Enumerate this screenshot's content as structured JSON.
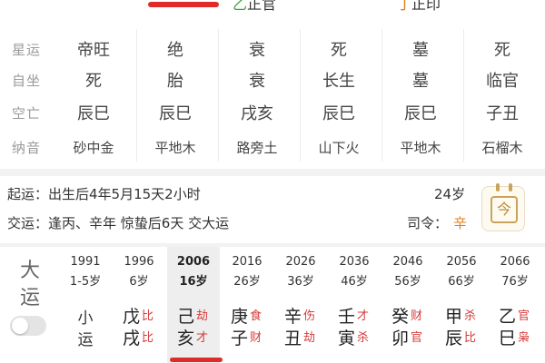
{
  "top": {
    "item1": {
      "glyph": "乙",
      "label": "正官"
    },
    "item2": {
      "glyph": "丁",
      "label": "正印"
    }
  },
  "pillars": {
    "rows": [
      {
        "label": "星运",
        "values": [
          "帝旺",
          "绝",
          "衰",
          "死",
          "墓",
          "死"
        ]
      },
      {
        "label": "自坐",
        "values": [
          "死",
          "胎",
          "衰",
          "长生",
          "墓",
          "临官"
        ]
      },
      {
        "label": "空亡",
        "values": [
          "辰巳",
          "辰巳",
          "戌亥",
          "辰巳",
          "辰巳",
          "子丑"
        ]
      },
      {
        "label": "纳音",
        "values": [
          "砂中金",
          "平地木",
          "路旁土",
          "山下火",
          "平地木",
          "石榴木"
        ]
      }
    ]
  },
  "qiyun": {
    "line1": "起运：出生后4年5月15天2小时",
    "age": "24岁",
    "line2": "交运：逢丙、辛年 惊蛰后6天 交大运",
    "siling_label": "司令：",
    "siling_value": "辛",
    "calendar_icon_char": "今"
  },
  "dayun": {
    "title_line1": "大",
    "title_line2": "运",
    "columns": [
      {
        "year": "1991",
        "age": "1-5岁",
        "xiao": [
          "小",
          "运"
        ]
      },
      {
        "year": "1996",
        "age": "6岁",
        "gan": "戊",
        "gan_ss": "比",
        "zhi": "戌",
        "zhi_ss": "比"
      },
      {
        "year": "2006",
        "age": "16岁",
        "gan": "己",
        "gan_ss": "劫",
        "zhi": "亥",
        "zhi_ss": "才"
      },
      {
        "year": "2016",
        "age": "26岁",
        "gan": "庚",
        "gan_ss": "食",
        "zhi": "子",
        "zhi_ss": "财"
      },
      {
        "year": "2026",
        "age": "36岁",
        "gan": "辛",
        "gan_ss": "伤",
        "zhi": "丑",
        "zhi_ss": "劫"
      },
      {
        "year": "2036",
        "age": "46岁",
        "gan": "壬",
        "gan_ss": "才",
        "zhi": "寅",
        "zhi_ss": "杀"
      },
      {
        "year": "2046",
        "age": "56岁",
        "gan": "癸",
        "gan_ss": "财",
        "zhi": "卯",
        "zhi_ss": "官"
      },
      {
        "year": "2056",
        "age": "66岁",
        "gan": "甲",
        "gan_ss": "杀",
        "zhi": "辰",
        "zhi_ss": "比"
      },
      {
        "year": "2066",
        "age": "76岁",
        "gan": "乙",
        "gan_ss": "官",
        "zhi": "巳",
        "zhi_ss": "枭"
      }
    ]
  },
  "colors": {
    "accent_red": "#e02b2b",
    "shishen_red": "#d53a3a",
    "green": "#3aa53a",
    "orange": "#e0801b"
  }
}
